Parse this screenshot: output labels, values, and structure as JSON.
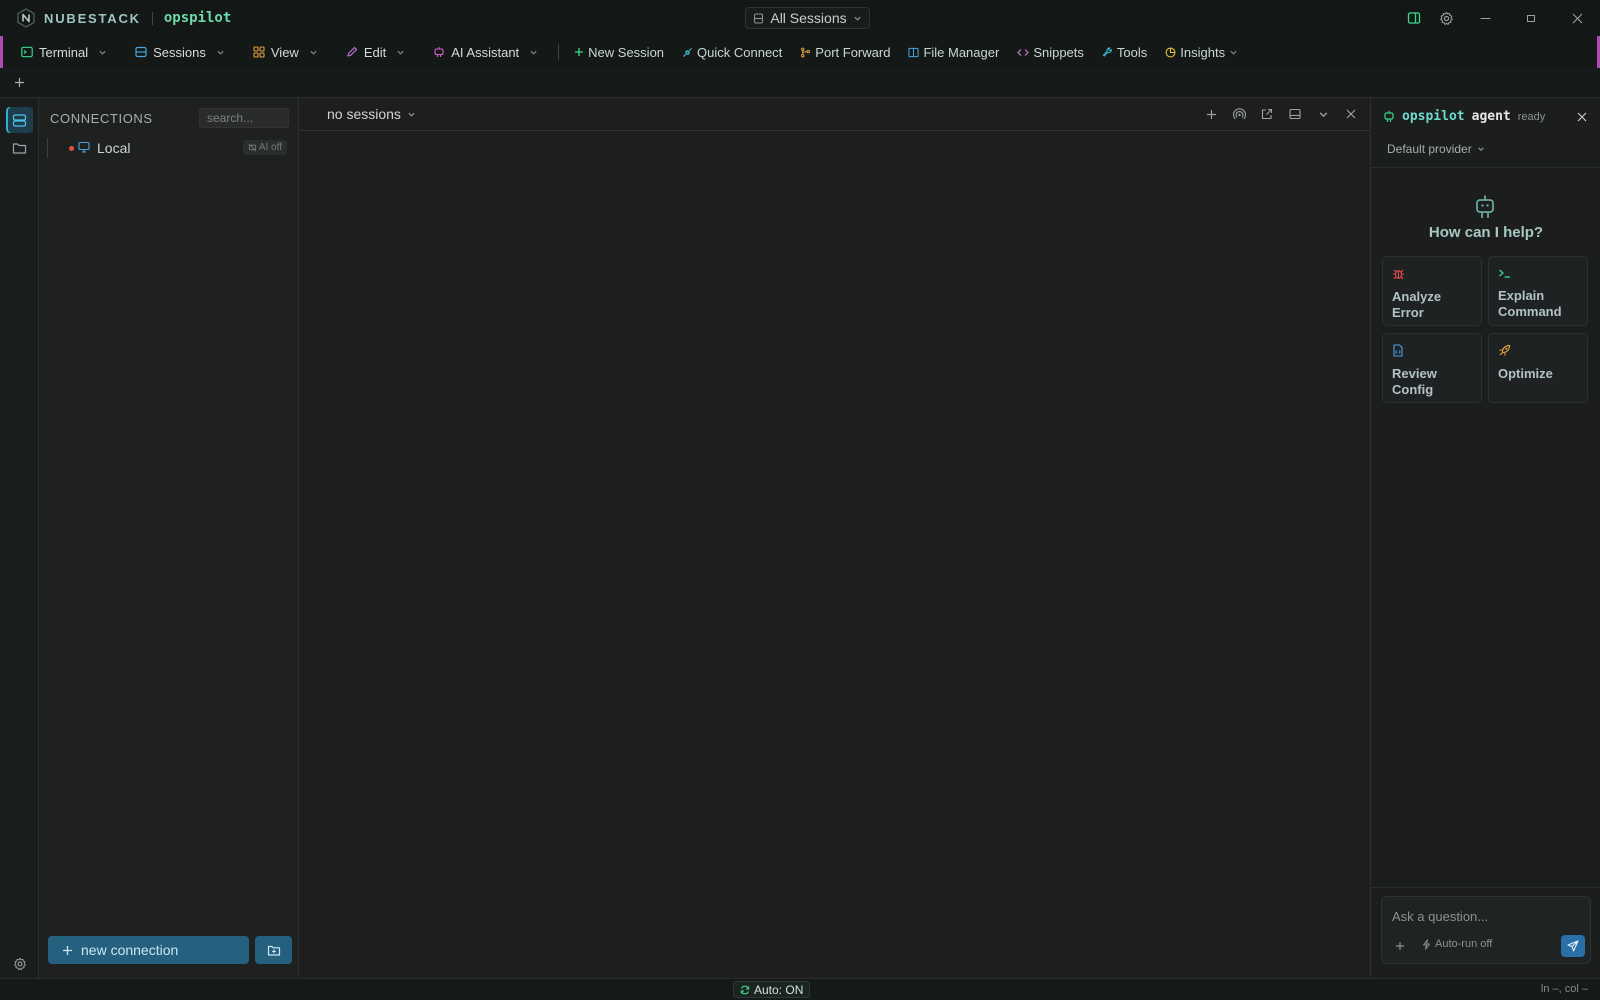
{
  "app": {
    "brand": "NUBESTACK",
    "product": "opspilot",
    "session_scope": "All Sessions"
  },
  "menubar": {
    "menus": [
      {
        "label": "Terminal",
        "icon": "terminal-icon"
      },
      {
        "label": "Sessions",
        "icon": "sessions-icon"
      },
      {
        "label": "View",
        "icon": "grid-icon"
      },
      {
        "label": "Edit",
        "icon": "pencil-icon"
      },
      {
        "label": "AI Assistant",
        "icon": "robot-icon"
      }
    ],
    "tools": [
      {
        "label": "New Session",
        "icon": "plus-icon"
      },
      {
        "label": "Quick Connect",
        "icon": "plug-icon"
      },
      {
        "label": "Port Forward",
        "icon": "git-branch-icon"
      },
      {
        "label": "File Manager",
        "icon": "columns-icon"
      },
      {
        "label": "Snippets",
        "icon": "code-icon"
      },
      {
        "label": "Tools",
        "icon": "wrench-icon"
      },
      {
        "label": "Insights",
        "icon": "pie-chart-icon"
      }
    ]
  },
  "sidebar": {
    "title": "CONNECTIONS",
    "search_placeholder": "search...",
    "connections": [
      {
        "name": "Local",
        "status": "offline",
        "badge": "AI off"
      }
    ],
    "new_connection_label": "new connection"
  },
  "main": {
    "session_select": "no sessions"
  },
  "agent": {
    "name": "opspilot",
    "name_suffix": "agent",
    "status": "ready",
    "provider": "Default provider",
    "greeting": "How can I help?",
    "quick_actions": [
      {
        "label": "Analyze Error",
        "icon": "bug-icon"
      },
      {
        "label": "Explain Command",
        "icon": "terminal-prompt-icon"
      },
      {
        "label": "Review Config",
        "icon": "file-code-icon"
      },
      {
        "label": "Optimize",
        "icon": "rocket-icon"
      }
    ],
    "input_placeholder": "Ask a question...",
    "autorun_label": "Auto-run off"
  },
  "statusbar": {
    "auto_label": "Auto: ON",
    "cursor_position": "ln –, col –"
  },
  "colors": {
    "accent_green": "#6fd9a8",
    "accent_teal": "#6ed9d0",
    "primary_button": "#26607f",
    "menubar_border": "#b04bb6",
    "error_red": "#e04f4f"
  }
}
